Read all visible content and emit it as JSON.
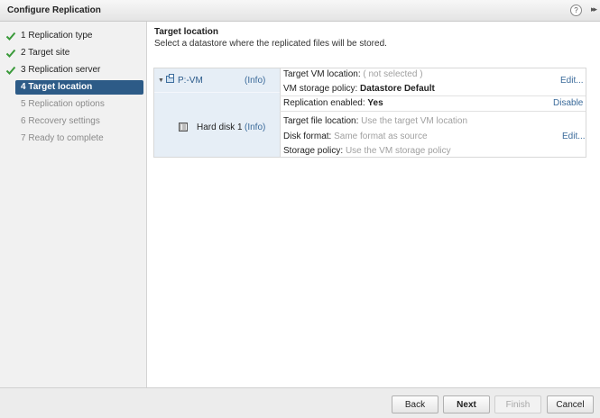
{
  "window": {
    "title": "Configure Replication",
    "help_icon": "?",
    "expand_icon": "▸▸"
  },
  "steps": [
    {
      "number": "1",
      "label": "Replication type",
      "state": "done"
    },
    {
      "number": "2",
      "label": "Target site",
      "state": "done"
    },
    {
      "number": "3",
      "label": "Replication server",
      "state": "done"
    },
    {
      "number": "4",
      "label": "Target location",
      "state": "active"
    },
    {
      "number": "5",
      "label": "Replication options",
      "state": "future"
    },
    {
      "number": "6",
      "label": "Recovery settings",
      "state": "future"
    },
    {
      "number": "7",
      "label": "Ready to complete",
      "state": "future"
    }
  ],
  "content": {
    "heading": "Target location",
    "subheading": "Select a datastore where the replicated files will be stored."
  },
  "vm": {
    "name": "P:-VM",
    "info_label": "(Info)",
    "target_vm_location_label": "Target VM location:",
    "target_vm_location_value": "( not selected )",
    "vm_storage_policy_label": "VM storage policy:",
    "vm_storage_policy_value": "Datastore Default",
    "edit_label": "Edit...",
    "replication_enabled_label": "Replication enabled:",
    "replication_enabled_value": "Yes",
    "disable_label": "Disable"
  },
  "disk": {
    "name": "Hard disk 1",
    "info_label": "(Info)",
    "target_file_location_label": "Target file location:",
    "target_file_location_value": "Use the target VM location",
    "disk_format_label": "Disk format:",
    "disk_format_value": "Same format as source",
    "storage_policy_label": "Storage policy:",
    "storage_policy_value": "Use the VM storage policy",
    "edit_label": "Edit..."
  },
  "footer": {
    "back": "Back",
    "next": "Next",
    "finish": "Finish",
    "cancel": "Cancel"
  },
  "colors": {
    "accent": "#2d5b87",
    "check": "#3a9a3a",
    "link": "#3a6a9a",
    "muted": "#a0a0a0"
  }
}
